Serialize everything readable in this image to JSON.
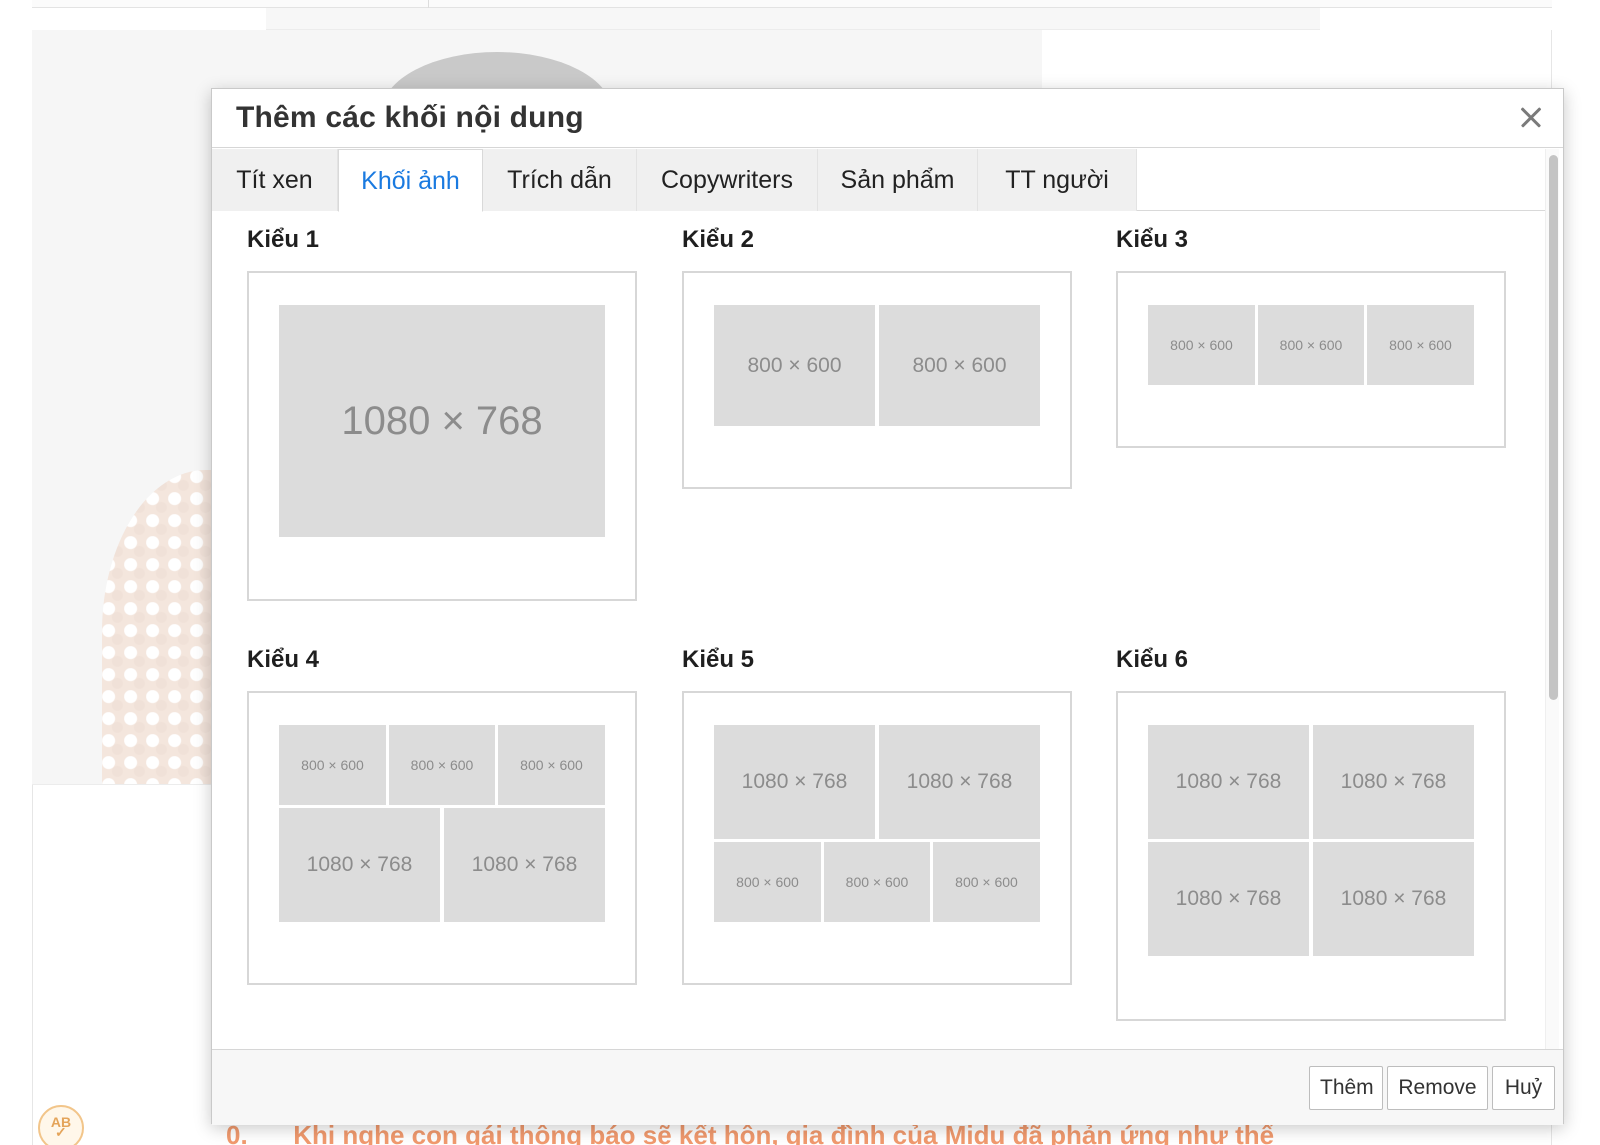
{
  "background": {
    "spell_badge": "AB",
    "article_number": "0.",
    "article_text": "Khi nghe con gái thông báo sẽ kết hôn, gia đình của Midu đã phản ứng như thế"
  },
  "dialog": {
    "title": "Thêm các khối nội dung",
    "close_icon": "close-icon",
    "tabs": [
      {
        "label": "Tít xen",
        "active": false
      },
      {
        "label": "Khối ảnh",
        "active": true
      },
      {
        "label": "Trích dẫn",
        "active": false
      },
      {
        "label": "Copywriters",
        "active": false
      },
      {
        "label": "Sản phẩm",
        "active": false
      },
      {
        "label": "TT người",
        "active": false
      }
    ],
    "styles": [
      {
        "title": "Kiểu 1",
        "images": [
          "1080 × 768"
        ]
      },
      {
        "title": "Kiểu 2",
        "images": [
          "800 × 600",
          "800 × 600"
        ]
      },
      {
        "title": "Kiểu 3",
        "images": [
          "800 × 600",
          "800 × 600",
          "800 × 600"
        ]
      },
      {
        "title": "Kiểu 4",
        "images": [
          "800 × 600",
          "800 × 600",
          "800 × 600",
          "1080 × 768",
          "1080 × 768"
        ]
      },
      {
        "title": "Kiểu 5",
        "images": [
          "1080 × 768",
          "1080 × 768",
          "800 × 600",
          "800 × 600",
          "800 × 600"
        ]
      },
      {
        "title": "Kiểu 6",
        "images": [
          "1080 × 768",
          "1080 × 768",
          "1080 × 768",
          "1080 × 768"
        ]
      }
    ],
    "footer": {
      "add_label": "Thêm",
      "remove_label": "Remove",
      "cancel_label": "Huỷ"
    }
  },
  "colors": {
    "active_tab": "#1a7ae0",
    "placeholder_bg": "#dcdcdc",
    "placeholder_text": "#8c8c8c",
    "article_text": "#f19a6e"
  }
}
